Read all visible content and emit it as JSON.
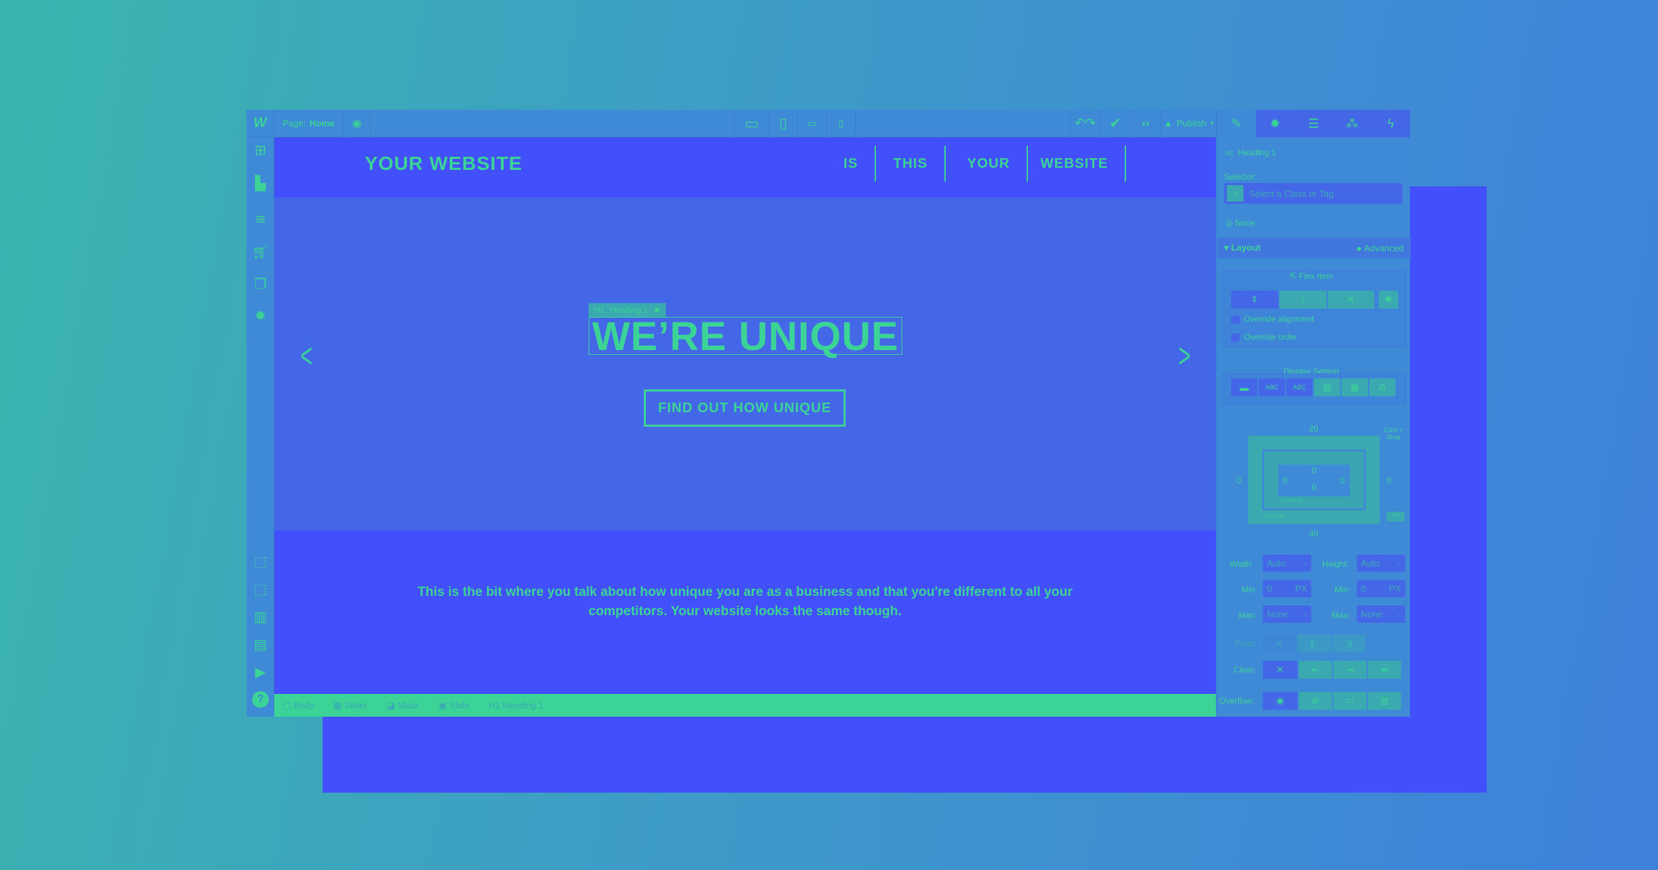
{
  "colors": {
    "background_start": "#3ab5ae",
    "background_end": "#3e80dc",
    "chrome": "#3f8ad6",
    "canvas": "#4150fb",
    "hero": "#4467e8",
    "accent": "#3bd496"
  },
  "toolbar": {
    "logo": "W",
    "page_label": "Page:",
    "page_name": "Home",
    "preview_icon": "eye-icon",
    "devices": [
      "desktop-icon",
      "tablet-icon",
      "mobile-landscape-icon",
      "mobile-portrait-icon"
    ],
    "undo_redo": "↶↷",
    "publish": "Publish"
  },
  "sidebar": {
    "top": [
      "add-icon",
      "pages-icon",
      "cms-icon",
      "ecommerce-icon",
      "assets-icon",
      "settings-icon"
    ],
    "bottom": [
      "select-element-icon",
      "show-edges-icon",
      "xray-icon",
      "guides-icon",
      "video-icon",
      "help-icon"
    ]
  },
  "site": {
    "brand": "YOUR WEBSITE",
    "nav": [
      "IS",
      "THIS",
      "YOUR",
      "WEBSITE"
    ],
    "heading_tag": "H1",
    "heading_label": "Heading 1",
    "heading": "WE’RE UNIQUE",
    "cta": "FIND OUT HOW UNIQUE",
    "paragraph": "This is the bit where you talk about how unique you are as a business and that you're different to all your competitors. Your website looks the same though."
  },
  "breadcrumbs": [
    "Body",
    "Slider",
    "Mask",
    "Slide",
    "Heading 1"
  ],
  "panel": {
    "tabs": [
      "style-brush-icon",
      "settings-gear-icon",
      "navigator-icon",
      "interactions-icon",
      "lightning-icon"
    ],
    "element_tag": "H1",
    "element_name": "Heading 1",
    "selector_label": "Selector:",
    "selector_placeholder": "Select a Class or Tag",
    "selector_state": "None",
    "layout_title": "Layout",
    "advanced": "Advanced",
    "flex_item": "Flex Item",
    "override_alignment": "Override alignment",
    "override_order": "Override order",
    "display_setting": "Display Setting",
    "display_options": [
      "block",
      "inline-block",
      "inline",
      "flex",
      "grid",
      "none"
    ],
    "spacing": {
      "margin_top": "20",
      "margin_bottom": "40",
      "margin_left": "0",
      "margin_right": "0",
      "padding_top": "0",
      "padding_bottom": "0",
      "padding_left": "0",
      "padding_right": "0",
      "hint": "Click + Drag",
      "padding_label": "PADDING",
      "margin_label": "MARGIN"
    },
    "width_label": "Width:",
    "width": "Auto",
    "height_label": "Height:",
    "height": "Auto",
    "min_label": "Min:",
    "min_w": "0",
    "min_h": "0",
    "unit": "PX",
    "max_label": "Max:",
    "max_w": "None",
    "max_h": "None",
    "float_label": "Float:",
    "clear_label": "Clear:",
    "overflow_label": "Overflow:"
  }
}
